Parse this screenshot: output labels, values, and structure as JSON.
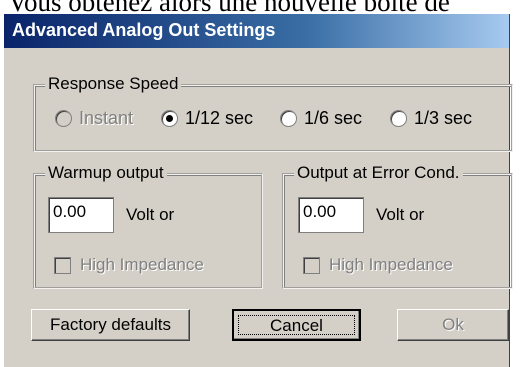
{
  "background": {
    "text": "Vous obtenez alors une nouvelle boîte de"
  },
  "window": {
    "title": "Advanced Analog Out Settings"
  },
  "response_speed": {
    "legend": "Response Speed",
    "options": [
      {
        "label": "Instant",
        "selected": false,
        "enabled": false
      },
      {
        "label": "1/12 sec",
        "selected": true,
        "enabled": true
      },
      {
        "label": "1/6 sec",
        "selected": false,
        "enabled": true
      },
      {
        "label": "1/3 sec",
        "selected": false,
        "enabled": true
      }
    ]
  },
  "warmup": {
    "legend": "Warmup output",
    "value": "0.00",
    "unit": "Volt or",
    "high_impedance_label": "High Impedance",
    "high_impedance_checked": false
  },
  "error_cond": {
    "legend": "Output at Error Cond.",
    "value": "0.00",
    "unit": "Volt or",
    "high_impedance_label": "High Impedance",
    "high_impedance_checked": false
  },
  "buttons": {
    "factory": "Factory defaults",
    "cancel": "Cancel",
    "ok": "Ok"
  },
  "colors": {
    "title_bar": "#0a246a",
    "face": "#d4d0c8"
  }
}
